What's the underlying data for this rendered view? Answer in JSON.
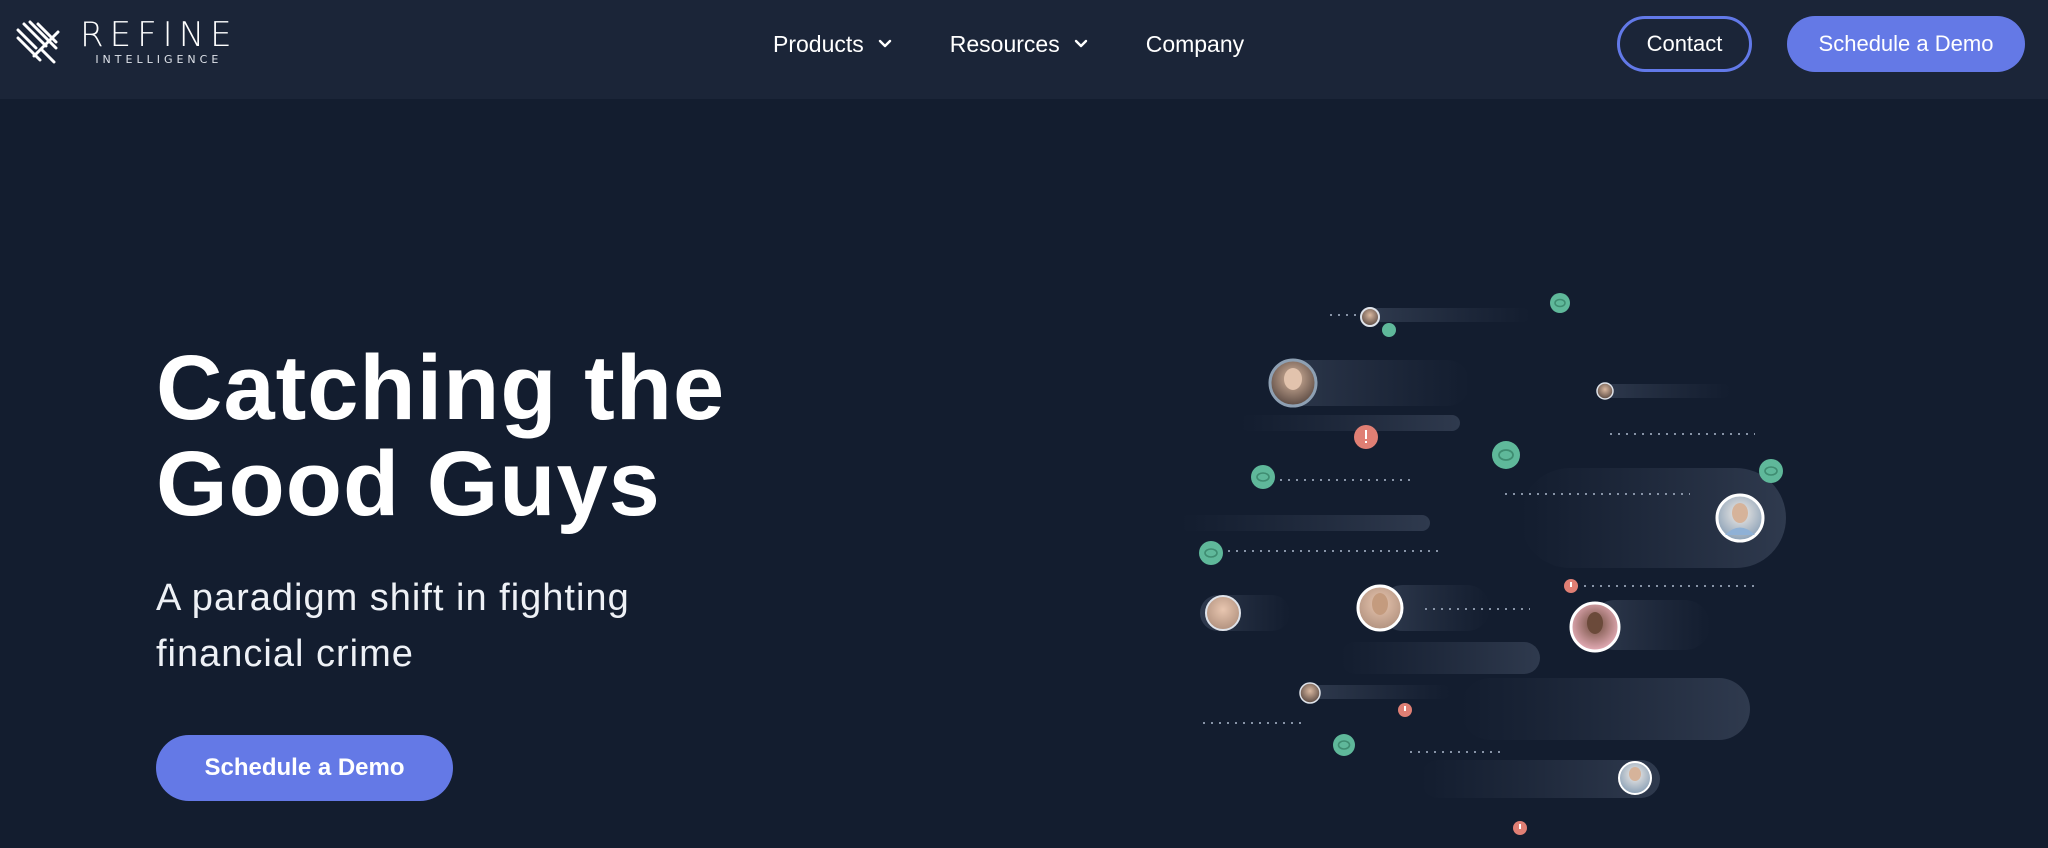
{
  "brand": {
    "name": "REFINE",
    "tagline": "INTELLIGENCE"
  },
  "nav": {
    "items": [
      {
        "label": "Products",
        "has_dropdown": true
      },
      {
        "label": "Resources",
        "has_dropdown": true
      },
      {
        "label": "Company",
        "has_dropdown": false
      }
    ],
    "contact_label": "Contact",
    "demo_label": "Schedule a Demo"
  },
  "hero": {
    "title_line1": "Catching the",
    "title_line2": "Good Guys",
    "subtitle_line1": "A paradigm shift in fighting",
    "subtitle_line2": "financial crime",
    "cta_label": "Schedule a Demo"
  },
  "colors": {
    "background": "#131d2f",
    "navbar": "#1b2538",
    "accent": "#6479e6",
    "good_marker": "#5fb89a",
    "alert_marker": "#e07f74"
  }
}
